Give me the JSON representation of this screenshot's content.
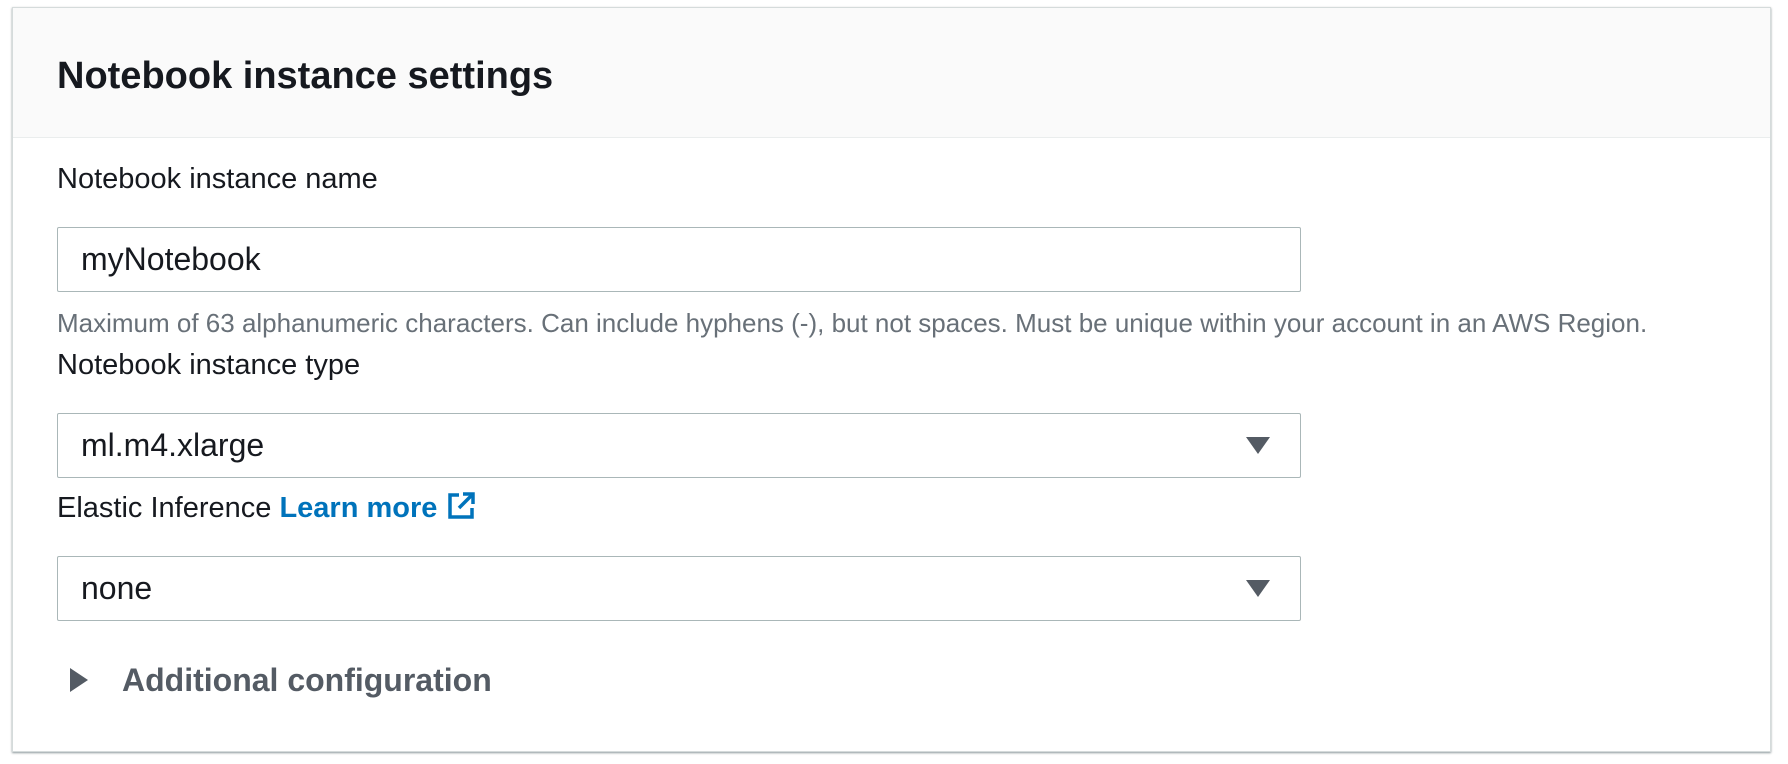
{
  "panel": {
    "title": "Notebook instance settings"
  },
  "name_field": {
    "label": "Notebook instance name",
    "value": "myNotebook",
    "hint": "Maximum of 63 alphanumeric characters. Can include hyphens (-), but not spaces. Must be unique within your account in an AWS Region."
  },
  "type_field": {
    "label": "Notebook instance type",
    "selected": "ml.m4.xlarge"
  },
  "inference_field": {
    "label": "Elastic Inference",
    "learn_more": "Learn more",
    "selected": "none"
  },
  "additional": {
    "label": "Additional configuration"
  },
  "icons": {
    "external_link": "external-link-icon",
    "dropdown": "caret-down-icon",
    "expand": "caret-right-icon"
  },
  "colors": {
    "link": "#0073bb",
    "text": "#16191f",
    "hint": "#687078",
    "border": "#aab7b8",
    "header_bg": "#fafafa"
  }
}
